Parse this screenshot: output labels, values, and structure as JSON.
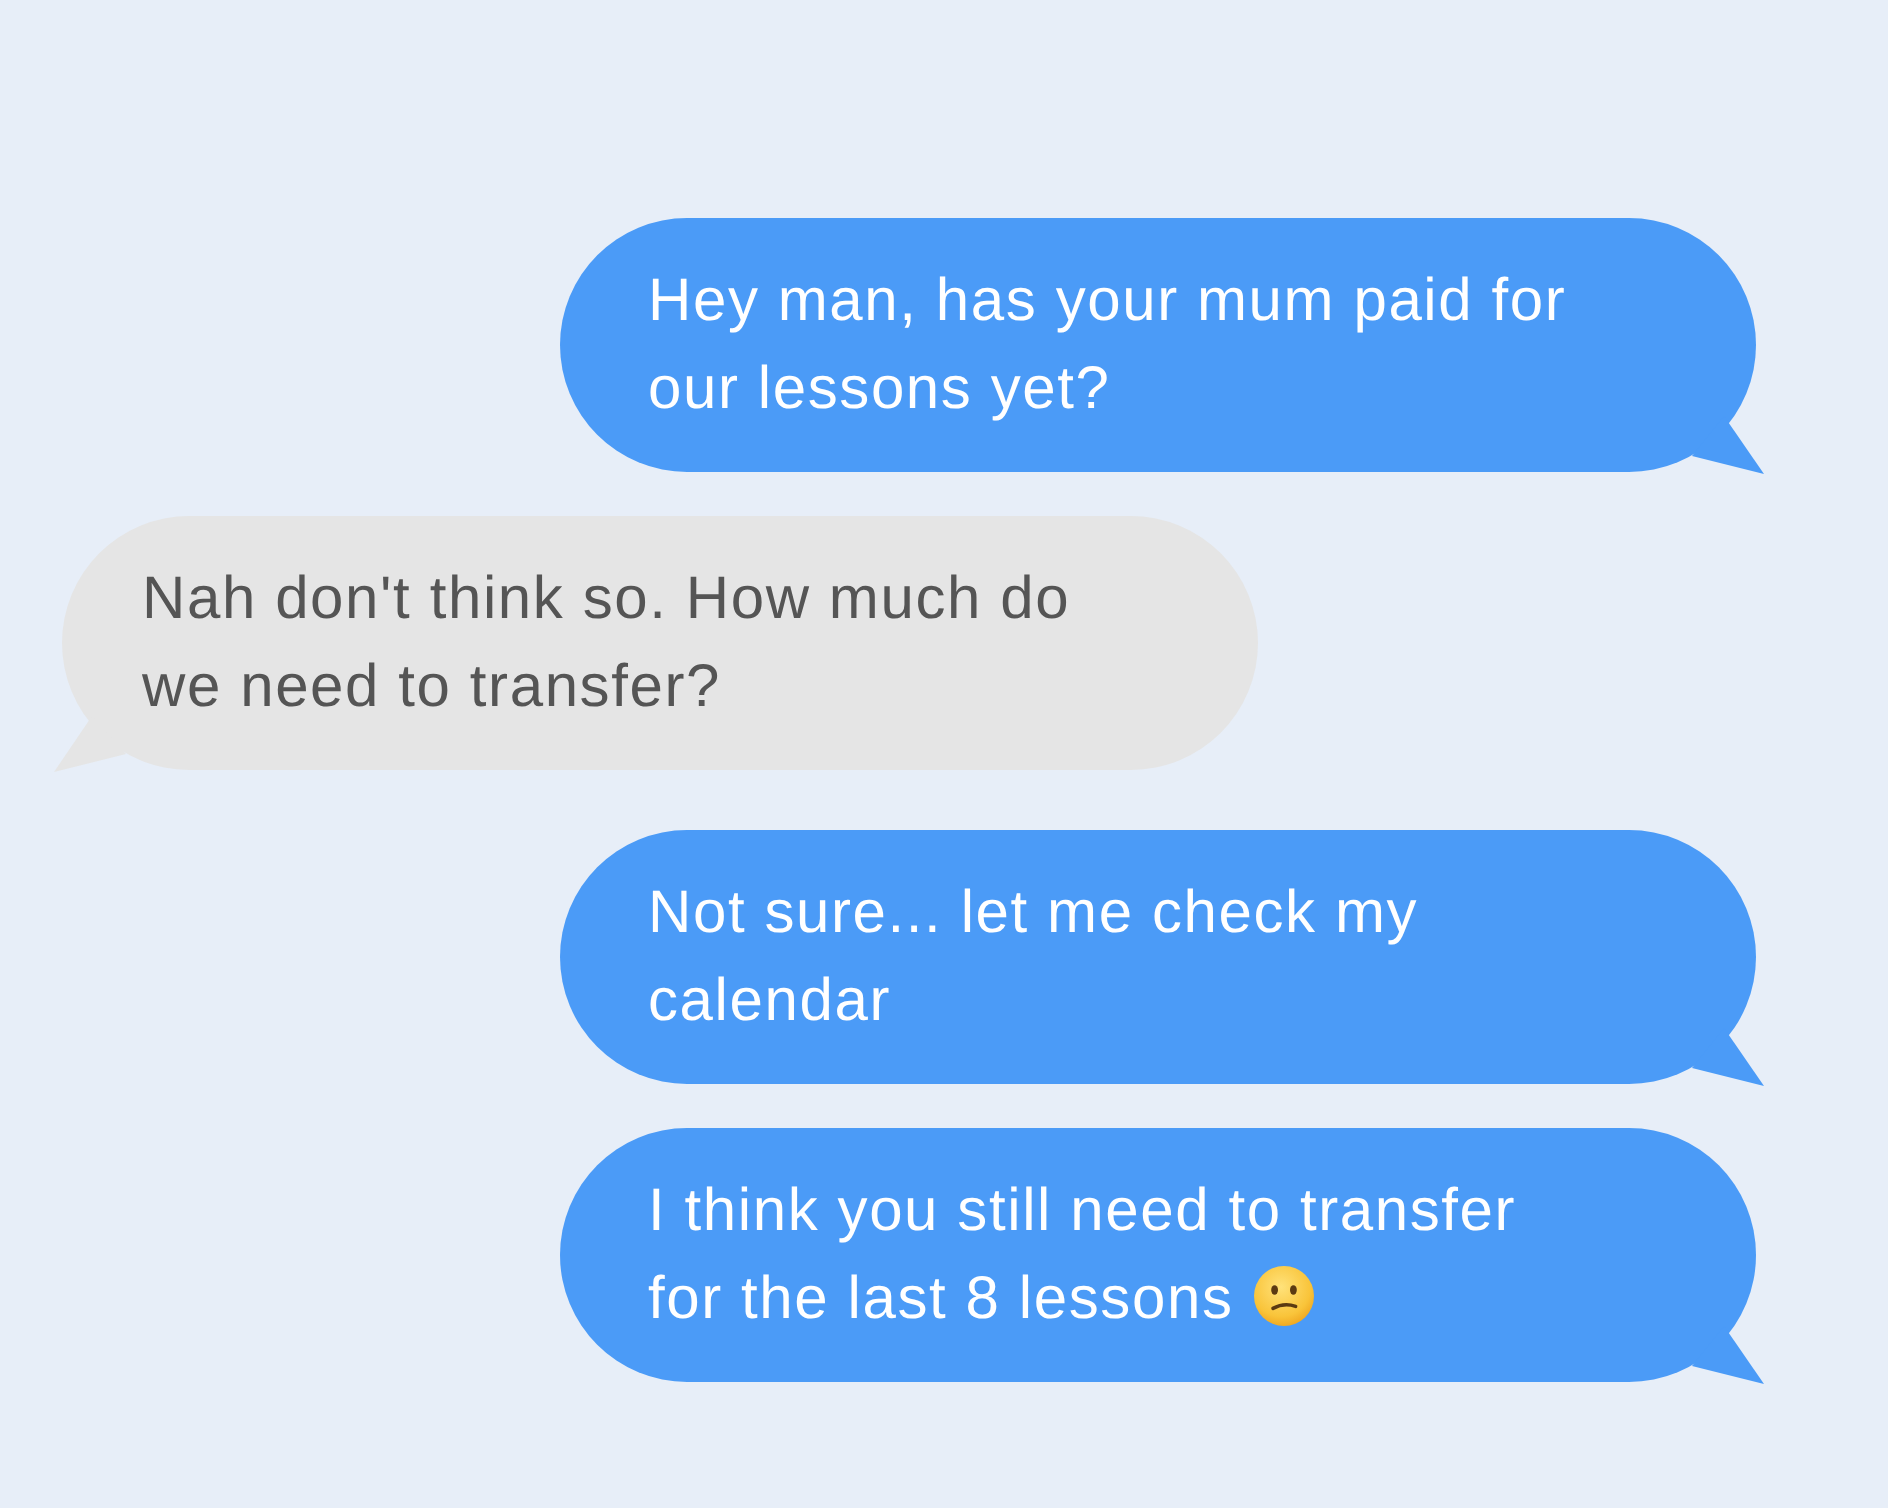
{
  "messages": [
    {
      "kind": "outgoing",
      "text": "Hey man, has your mum paid for our lessons yet?",
      "trailing_icon": false
    },
    {
      "kind": "incoming",
      "text": "Nah don't think so. How much do we need to transfer?",
      "trailing_icon": false
    },
    {
      "kind": "outgoing",
      "text": "Not sure... let me check my calendar",
      "trailing_icon": false
    },
    {
      "kind": "outgoing",
      "text": "I think you still need to transfer for the last 8 lessons",
      "trailing_icon": true
    }
  ]
}
